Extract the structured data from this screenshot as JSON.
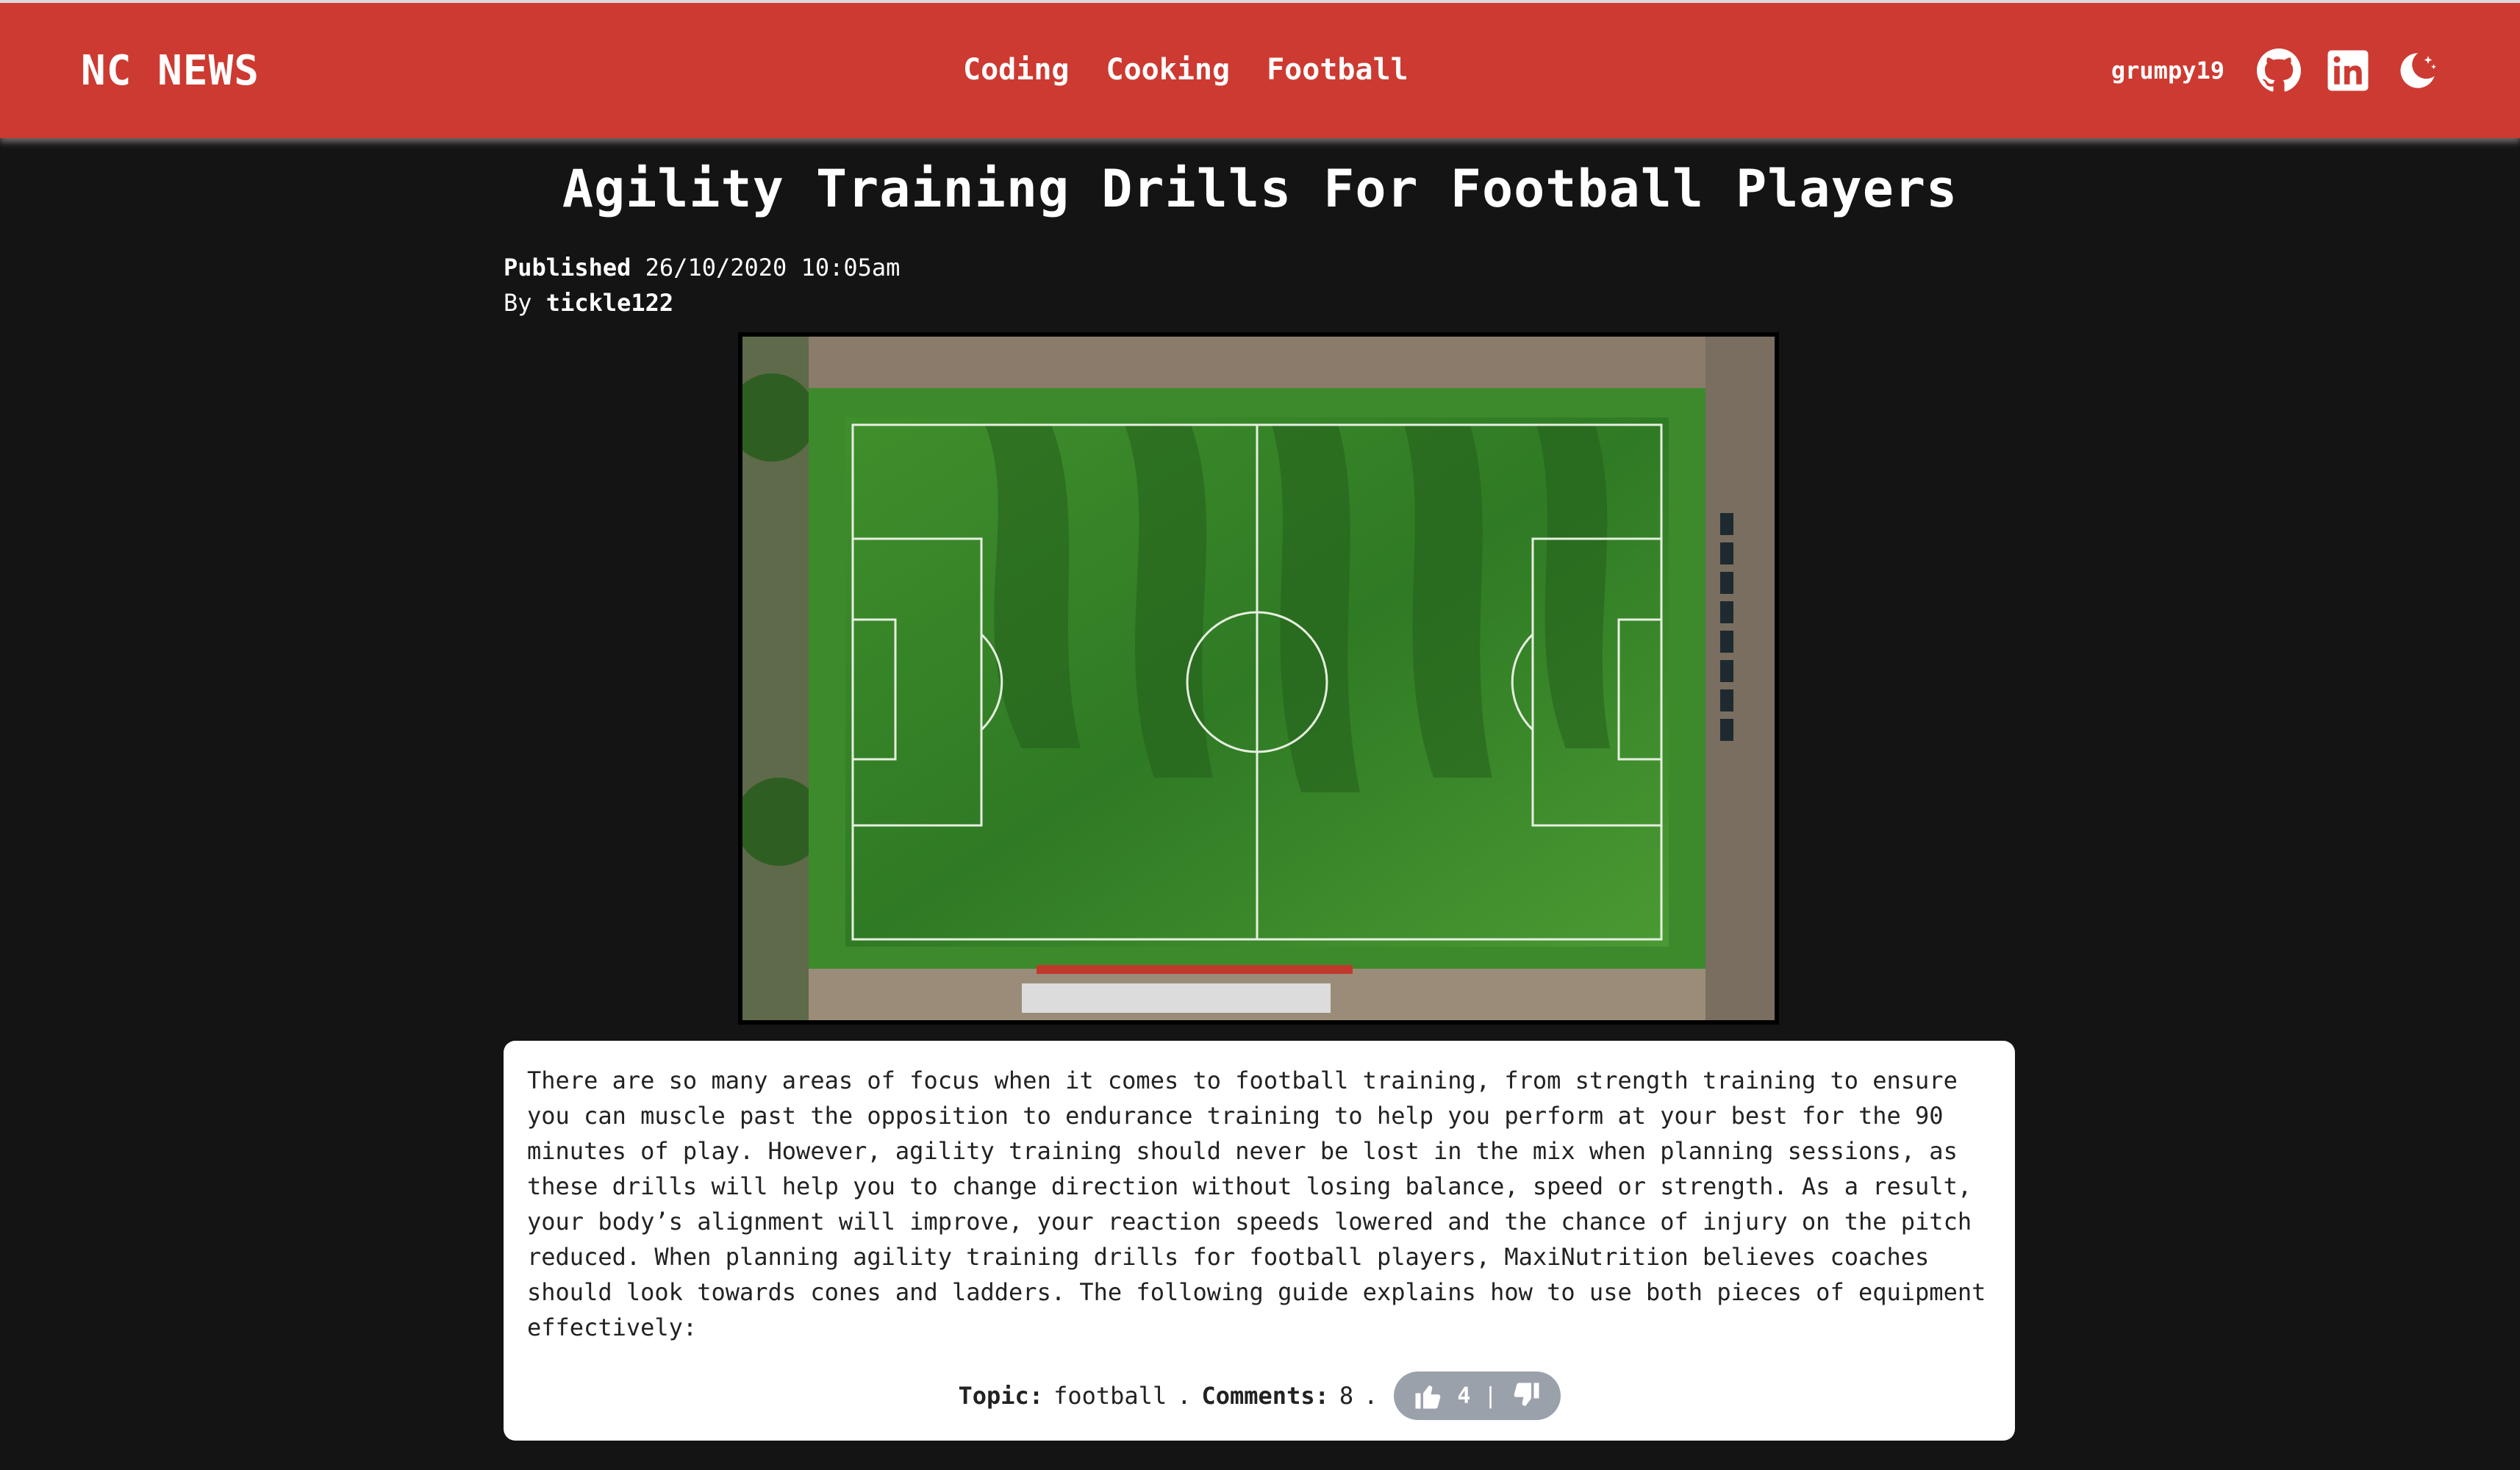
{
  "header": {
    "brand": "NC NEWS",
    "nav": [
      "Coding",
      "Cooking",
      "Football"
    ],
    "username": "grumpy19",
    "icons": [
      "github-icon",
      "linkedin-icon",
      "dark-mode-icon"
    ],
    "accent_color": "#cd3a31"
  },
  "article": {
    "title": "Agility Training Drills For Football Players",
    "published_label": "Published",
    "published_date": "26/10/2020 10:05am",
    "by_label": "By",
    "author": "tickle122",
    "image_alt": "aerial football pitch",
    "body": "There are so many areas of focus when it comes to football training, from strength training to ensure you can muscle past the opposition to endurance training to help you perform at your best for the 90 minutes of play. However, agility training should never be lost in the mix when planning sessions, as these drills will help you to change direction without losing balance, speed or strength. As a result, your body’s alignment will improve, your reaction speeds lowered and the chance of injury on the pitch reduced. When planning agility training drills for football players, MaxiNutrition believes coaches should look towards cones and ladders. The following guide explains how to use both pieces of equipment effectively:",
    "topic_label": "Topic:",
    "topic": "football",
    "separator": ".",
    "comments_label": "Comments:",
    "comments": "8",
    "votes": "4",
    "vote_separator": "|"
  }
}
